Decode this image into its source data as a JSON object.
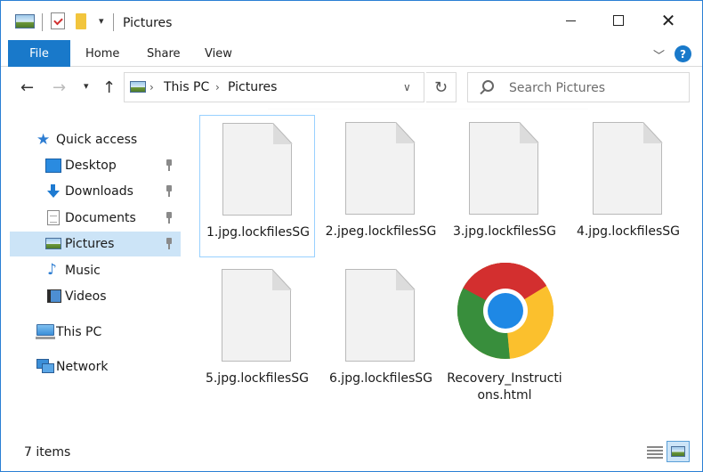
{
  "window": {
    "title": "Pictures"
  },
  "ribbon": {
    "file": "File",
    "home": "Home",
    "share": "Share",
    "view": "View",
    "help": "?"
  },
  "nav": {
    "crumb_this_pc": "This PC",
    "crumb_pictures": "Pictures",
    "search_placeholder": "Search Pictures"
  },
  "sidebar": {
    "items": [
      {
        "label": "Quick access"
      },
      {
        "label": "Desktop"
      },
      {
        "label": "Downloads"
      },
      {
        "label": "Documents"
      },
      {
        "label": "Pictures"
      },
      {
        "label": "Music"
      },
      {
        "label": "Videos"
      },
      {
        "label": "This PC"
      },
      {
        "label": "Network"
      }
    ]
  },
  "files": [
    {
      "name": "1.jpg.lockfilesSG",
      "icon": "document-icon"
    },
    {
      "name": "2.jpeg.lockfilesSG",
      "icon": "document-icon"
    },
    {
      "name": "3.jpg.lockfilesSG",
      "icon": "document-icon"
    },
    {
      "name": "4.jpg.lockfilesSG",
      "icon": "document-icon"
    },
    {
      "name": "5.jpg.lockfilesSG",
      "icon": "document-icon"
    },
    {
      "name": "6.jpg.lockfilesSG",
      "icon": "document-icon"
    },
    {
      "name": "Recovery_Instructions.html",
      "icon": "chrome-icon"
    }
  ],
  "status": {
    "items_count": "7 items"
  },
  "colors": {
    "accent": "#1979ca",
    "selection": "#cce4f7",
    "focus_border": "#99d1ff"
  }
}
